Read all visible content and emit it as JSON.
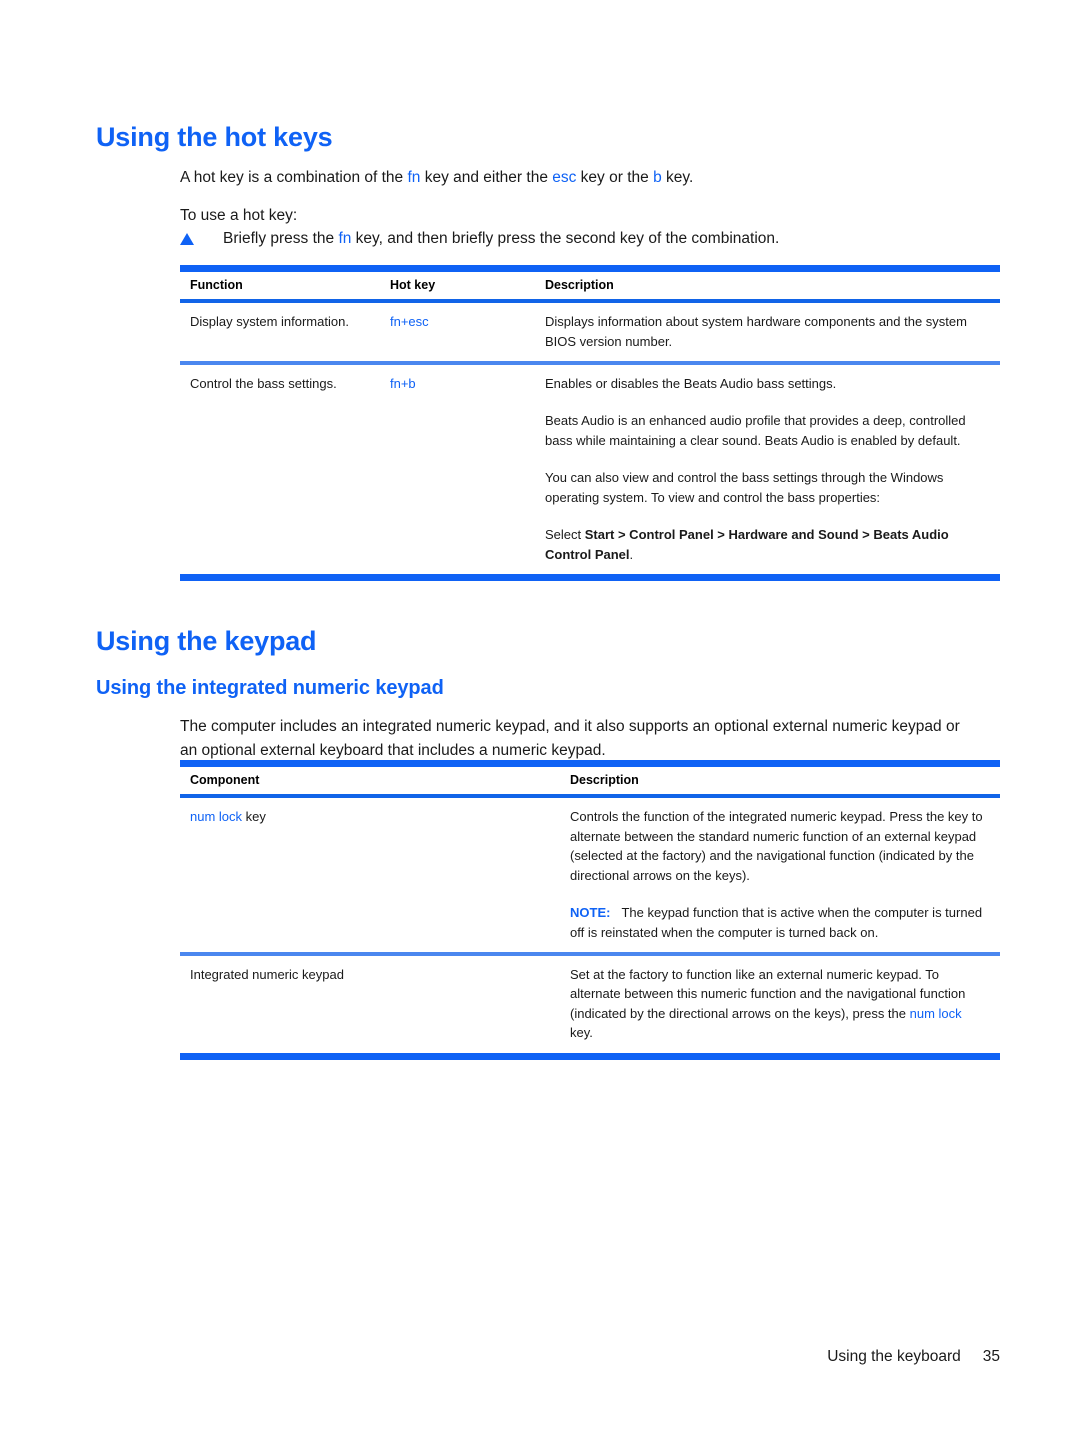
{
  "page": {
    "footer_section": "Using the keyboard",
    "footer_page_number": "35",
    "accent_color": "#0f62f5",
    "text_color": "#1a1a1a"
  },
  "section_hotkeys": {
    "heading": "Using the hot keys",
    "intro_parts": {
      "p1_a": "A hot key is a combination of the ",
      "p1_fn": "fn",
      "p1_b": " key and either the ",
      "p1_esc": "esc",
      "p1_c": " key or the ",
      "p1_bkey": "b",
      "p1_d": " key."
    },
    "to_use": "To use a hot key:",
    "bullet": {
      "marker": "triangle-bullet-icon",
      "a": "Briefly press the ",
      "fn": "fn",
      "b": " key, and then briefly press the second key of the combination."
    },
    "table": {
      "headers": [
        "Function",
        "Hot key",
        "Description"
      ],
      "rows": [
        {
          "function": "Display system information.",
          "hotkey": "fn+esc",
          "description_paragraphs": [
            "Displays information about system hardware components and the system BIOS version number."
          ]
        },
        {
          "function": "Control the bass settings.",
          "hotkey": "fn+b",
          "description_paragraphs": [
            "Enables or disables the Beats Audio bass settings.",
            "Beats Audio is an enhanced audio profile that provides a deep, controlled bass while maintaining a clear sound. Beats Audio is enabled by default.",
            "You can also view and control the bass settings through the Windows operating system. To view and control the bass properties:"
          ],
          "select_line": {
            "lead": "Select ",
            "path": "Start > Control Panel > Hardware and Sound > Beats Audio Control Panel",
            "tail": "."
          }
        }
      ]
    }
  },
  "section_keypad": {
    "heading": "Using the keypad",
    "subheading": "Using the integrated numeric keypad",
    "intro": "The computer includes an integrated numeric keypad, and it also supports an optional external numeric keypad or an optional external keyboard that includes a numeric keypad.",
    "table": {
      "headers": [
        "Component",
        "Description"
      ],
      "rows": [
        {
          "component_key": "num lock",
          "component_suffix": " key",
          "description": "Controls the function of the integrated numeric keypad. Press the key to alternate between the standard numeric function of an external keypad (selected at the factory) and the navigational function (indicated by the directional arrows on the keys).",
          "note_label": "NOTE:",
          "note_text": "The keypad function that is active when the computer is turned off is reinstated when the computer is turned back on."
        },
        {
          "component": "Integrated numeric keypad",
          "description_a": "Set at the factory to function like an external numeric keypad. To alternate between this numeric function and the navigational function (indicated by the directional arrows on the keys), press the ",
          "description_key": "num lock",
          "description_b": " key."
        }
      ]
    }
  }
}
